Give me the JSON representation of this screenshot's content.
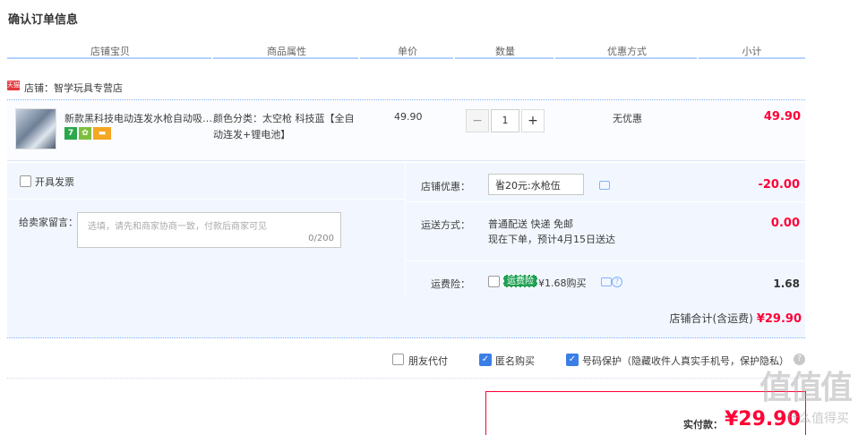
{
  "page": {
    "title": "确认订单信息"
  },
  "columns": [
    "店铺宝贝",
    "商品属性",
    "单价",
    "数量",
    "优惠方式",
    "小计"
  ],
  "shop": {
    "icon_text": "天猫",
    "label": "店铺：智学玩具专营店"
  },
  "item": {
    "title": "新款黑科技电动连发水枪自动吸…",
    "badges": [
      "7",
      "✿",
      "▬"
    ],
    "property": "颜色分类：太空枪 科技蓝【全自动连发+锂电池】",
    "unit_price": "49.90",
    "quantity": "1",
    "qty_minus": "−",
    "qty_plus": "+",
    "discount": "无优惠",
    "subtotal": "49.90"
  },
  "invoice": {
    "label": "开具发票"
  },
  "note": {
    "label": "给卖家留言：",
    "placeholder": "选填，请先和商家协商一致，付款后商家可见",
    "counter": "0/200"
  },
  "shop_discount": {
    "label": "店铺优惠：",
    "selected": "省20元:水枪伍",
    "amount": "-20.00"
  },
  "shipping": {
    "label": "运送方式：",
    "line1": "普通配送 快递 免邮",
    "line2": "现在下单，预计4月15日送达",
    "amount": "0.00"
  },
  "insurance": {
    "label": "运费险：",
    "badge": "运费险",
    "price": "¥1.68购买",
    "amount": "1.68"
  },
  "shop_total": {
    "label": "店铺合计(含运费)",
    "amount": "¥29.90"
  },
  "extras": {
    "friend_pay": "朋友代付",
    "anonymous": "匿名购买",
    "number_protect": "号码保护（隐藏收件人真实手机号，保护隐私）"
  },
  "payment": {
    "label": "实付款：",
    "amount": "¥29.90"
  },
  "watermark": {
    "main": "值值值",
    "sub": "什么值得买"
  }
}
